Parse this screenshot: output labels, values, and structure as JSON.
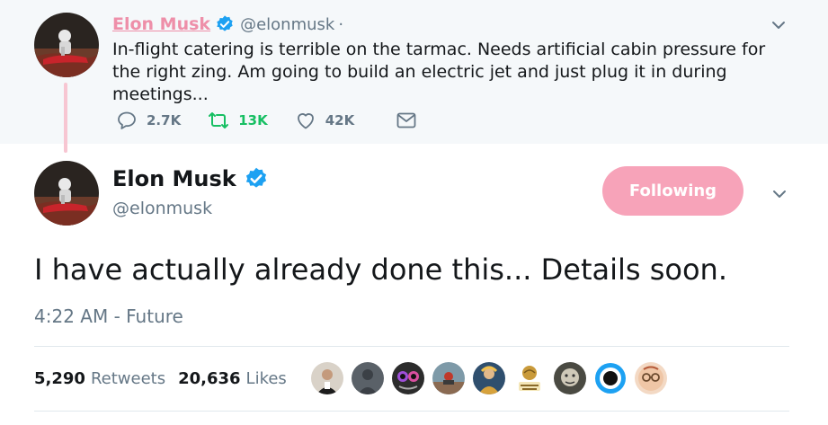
{
  "parent_tweet": {
    "author_name": "Elon Musk",
    "handle": "@elonmusk",
    "separator": "·",
    "text": "In-flight catering is terrible on the tarmac. Needs artificial cabin pressure for the right zing. Am going to build an electric jet and just plug it in during meetings...",
    "actions": {
      "reply_count": "2.7K",
      "retweet_count": "13K",
      "like_count": "42K"
    },
    "icons": [
      "reply-icon",
      "retweet-icon",
      "like-icon",
      "message-icon",
      "chevron-down-icon",
      "verified-badge-icon"
    ]
  },
  "main_tweet": {
    "author_name": "Elon Musk",
    "handle": "@elonmusk",
    "follow_button_label": "Following",
    "text": "I have actually already done this... Details soon.",
    "timestamp": "4:22 AM - Future",
    "stats": {
      "retweets_count": "5,290",
      "retweets_label": "Retweets",
      "likes_count": "20,636",
      "likes_label": "Likes"
    },
    "liker_avatars_count": 9
  },
  "colors": {
    "accent_pink": "#ee8fa9",
    "follow_button": "#f7a3b9",
    "thread_line": "#f7c6d2",
    "retweet_green": "#17bf63",
    "verified_blue": "#1da1f2",
    "secondary_text": "#657786",
    "parent_background": "#f5f8fa"
  }
}
